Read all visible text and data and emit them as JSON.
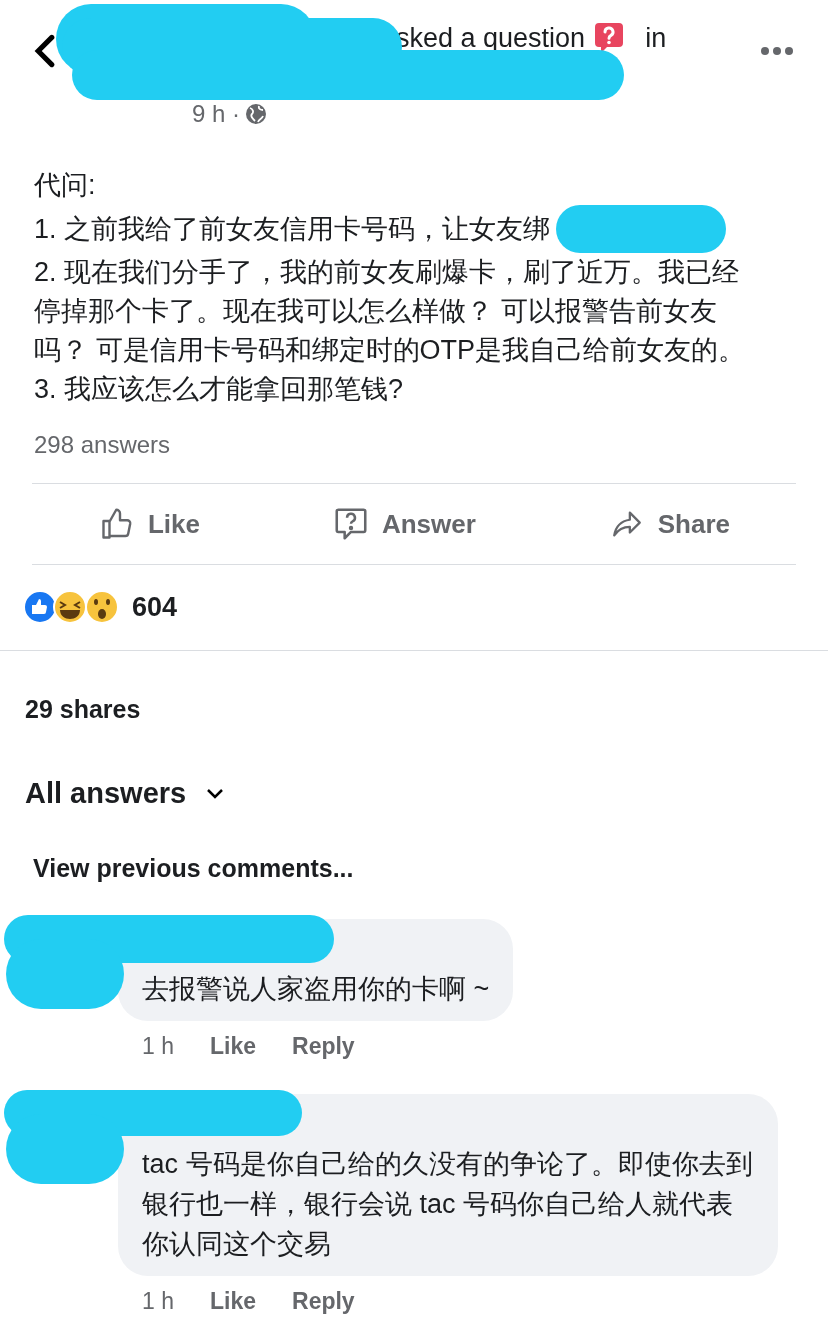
{
  "header": {
    "title_fragment": "sked a question",
    "title_suffix": "in",
    "time": "9 h ·"
  },
  "question": {
    "lines": [
      {
        "text": "代问:",
        "redacted": false
      },
      {
        "text": "1. 之前我给了前女友信用卡号码，让女友绑",
        "redacted": true
      },
      {
        "text": "2. 现在我们分手了，我的前女友刷爆卡，刷了近万。我已经停掉那个卡了。现在我可以怎么样做？ 可以报警告前女友吗？ 可是信用卡号码和绑定时的OTP是我自己给前女友的。",
        "redacted": false
      },
      {
        "text": "3. 我应该怎么才能拿回那笔钱?",
        "redacted": false
      }
    ],
    "answers_count": "298 answers"
  },
  "actions": [
    {
      "kind": "like",
      "label": "Like"
    },
    {
      "kind": "answer",
      "label": "Answer"
    },
    {
      "kind": "share",
      "label": "Share"
    }
  ],
  "reactions": {
    "count": "604"
  },
  "shares": "29 shares",
  "all_answers": "All answers",
  "view_previous": "View previous comments...",
  "comments": [
    {
      "text": "去报警说人家盗用你的卡啊 ~",
      "time": "1 h",
      "like": "Like",
      "reply": "Reply"
    },
    {
      "text": "tac 号码是你自己给的久没有的争论了。即使你去到银行也一样，银行会说 tac 号码你自己给人就代表你认同这个交易",
      "time": "1 h",
      "like": "Like",
      "reply": "Reply"
    }
  ]
}
